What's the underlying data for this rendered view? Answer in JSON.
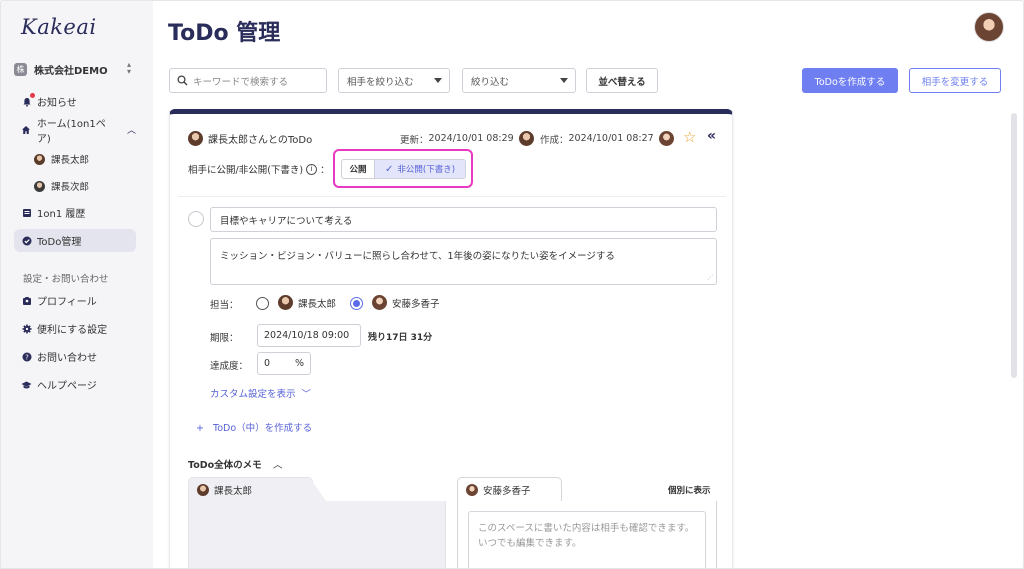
{
  "app": {
    "logo": "Kakeai",
    "page_title": "ToDo 管理"
  },
  "sidebar": {
    "org": {
      "badge": "株",
      "name": "株式会社DEMO"
    },
    "items": [
      {
        "label": "お知らせ",
        "icon": "bell-icon"
      },
      {
        "label": "ホーム(1on1ペア)",
        "icon": "home-icon"
      },
      {
        "label": "1on1 履歴",
        "icon": "history-icon"
      },
      {
        "label": "ToDo管理",
        "icon": "check-circle-icon",
        "active": true
      }
    ],
    "sub_items": [
      "課長太郎",
      "課長次郎"
    ],
    "section_label": "設定・お問い合わせ",
    "settings_items": [
      {
        "label": "プロフィール",
        "icon": "profile-icon"
      },
      {
        "label": "便利にする設定",
        "icon": "gear-icon"
      },
      {
        "label": "お問い合わせ",
        "icon": "question-icon"
      },
      {
        "label": "ヘルプページ",
        "icon": "graduation-cap-icon"
      }
    ]
  },
  "toolbar": {
    "search_placeholder": "キーワードで検索する",
    "filter_partner": "相手を絞り込む",
    "filter": "絞り込む",
    "sort": "並べ替える",
    "create": "ToDoを作成する",
    "change_partner": "相手を変更する"
  },
  "card": {
    "owner": "課長太郎さんとのToDo",
    "updated_label": "更新：",
    "updated": "2024/10/01 08:29",
    "created_label": "作成：",
    "created": "2024/10/01 08:27",
    "visibility_label": "相手に公開/非公開(下書き)",
    "visibility_colon": "：",
    "visibility_public": "公開",
    "visibility_private": "非公開(下書き)",
    "todo_title": "目標やキャリアについて考える",
    "todo_desc": "ミッション・ビジョン・バリューに照らし合わせて、1年後の姿になりたい姿をイメージする",
    "assignee_label": "担当：",
    "assignees": [
      "課長太郎",
      "安藤多香子"
    ],
    "selected_assignee": "安藤多香子",
    "due_label": "期限：",
    "due": "2024/10/18 09:00",
    "remaining": "残り17日 31分",
    "progress_label": "達成度：",
    "progress": "0",
    "progress_unit": "%",
    "custom_settings": "カスタム設定を表示",
    "add_sub_todo": "ToDo（中）を作成する",
    "memo_title": "ToDo全体のメモ",
    "memo_left_name": "課長太郎",
    "memo_right_name": "安藤多香子",
    "show_individual": "個別に表示",
    "memo_placeholder": "このスペースに書いた内容は相手も確認できます。いつでも編集できます。"
  },
  "colors": {
    "navy": "#2a2c5a",
    "accent": "#6f7ff1",
    "highlight": "#e83ac1",
    "star": "#e9a12b"
  }
}
